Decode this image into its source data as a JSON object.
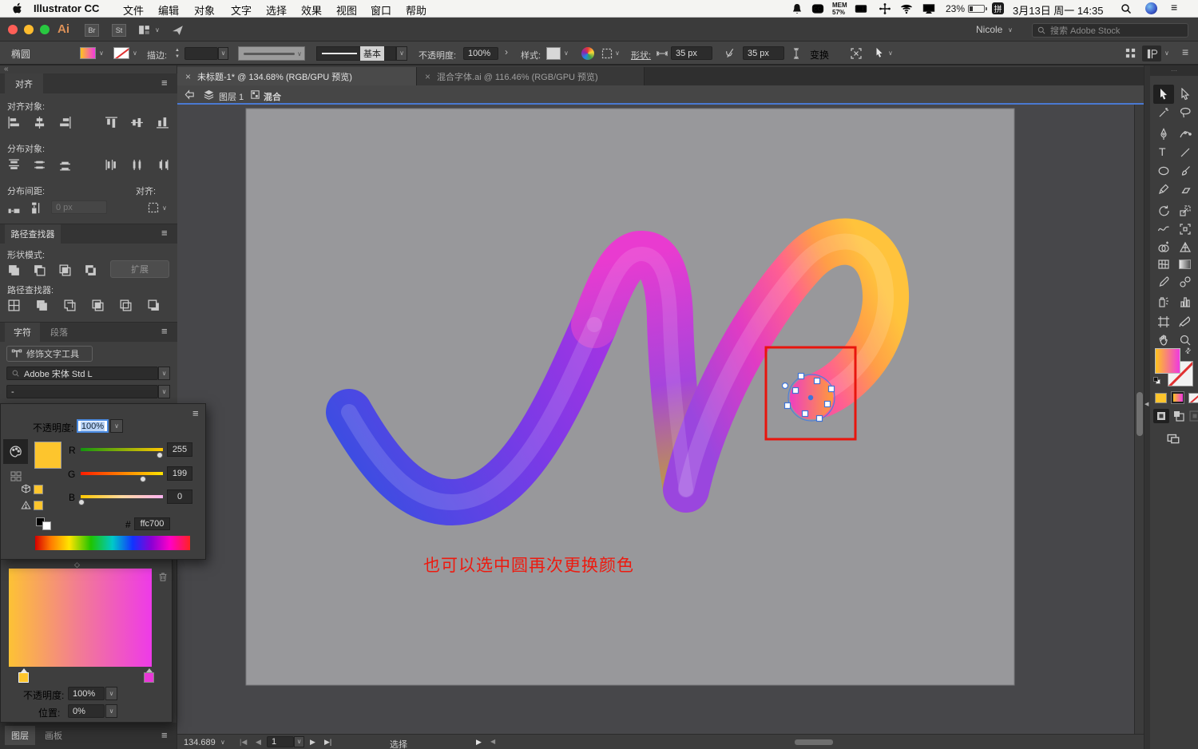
{
  "menu_bar": {
    "app_name": "Illustrator CC",
    "menus": [
      "文件",
      "编辑",
      "对象",
      "文字",
      "选择",
      "效果",
      "视图",
      "窗口",
      "帮助"
    ],
    "mem": "MEM",
    "mem_pct": "57%",
    "battery_pct": "23%",
    "input_badge": "拼",
    "datetime": "3月13日 周一 14:35"
  },
  "title_bar": {
    "bridge": "Br",
    "stock": "St",
    "user": "Nicole",
    "search_placeholder": "搜索 Adobe Stock"
  },
  "control_bar": {
    "tool_name": "椭圆",
    "stroke_label": "描边:",
    "brush_style": "基本",
    "opacity_label": "不透明度:",
    "opacity_value": "100%",
    "style_label": "样式:",
    "shape_label": "形状:",
    "shape_width": "35 px",
    "shape_height": "35 px",
    "transform_label": "变换"
  },
  "doc_tabs": {
    "tab1": "未标题-1* @ 134.68% (RGB/GPU 预览)",
    "tab2": "混合字体.ai @ 116.46% (RGB/GPU 预览)"
  },
  "breadcrumb": {
    "layer": "图层 1",
    "object": "混合"
  },
  "align_panel": {
    "tab": "对齐",
    "align_objects": "对齐对象:",
    "distribute_objects": "分布对象:",
    "distribute_spacing": "分布间距:",
    "spacing_value": "0 px",
    "align_to": "对齐:"
  },
  "pathfinder_panel": {
    "tab": "路径查找器",
    "shape_modes": "形状模式:",
    "expand_button": "扩展",
    "pathfinders": "路径查找器:"
  },
  "character_panel": {
    "tab_character": "字符",
    "tab_paragraph": "段落",
    "touch_type_button": "修饰文字工具",
    "font_name": "Adobe 宋体 Std L",
    "font_style": "-"
  },
  "color_panel": {
    "opacity_label": "不透明度:",
    "opacity_value": "100%",
    "channels": [
      {
        "label": "R",
        "value": "255"
      },
      {
        "label": "G",
        "value": "199"
      },
      {
        "label": "B",
        "value": "0"
      }
    ],
    "hex_label": "#",
    "hex_value": "ffc700"
  },
  "gradient_panel": {
    "opacity_label": "不透明度:",
    "opacity_value": "100%",
    "position_label": "位置:",
    "position_value": "0%"
  },
  "bottom_tabs": {
    "layers": "图层",
    "artboards": "画板"
  },
  "status_bar": {
    "zoom": "134.689",
    "page": "1",
    "tool_status": "选择"
  },
  "canvas": {
    "annotation": "也可以选中圆再次更换颜色"
  },
  "glyphs": {
    "close": "×",
    "chevron": "∨",
    "hchev": "›",
    "menu": "≡",
    "up": "▲",
    "down": "▼",
    "swap": "⇄",
    "diamond": "◇",
    "double_left": "«",
    "dots": "⋯",
    "nav_first": "|◀",
    "nav_prev": "◀",
    "nav_next": "▶",
    "nav_last": "▶|",
    "play": "▶"
  },
  "colors": {
    "fill_hex": "#ffc700",
    "accent_blue": "#4a79d2",
    "annotation_red": "#ed1a0f"
  }
}
